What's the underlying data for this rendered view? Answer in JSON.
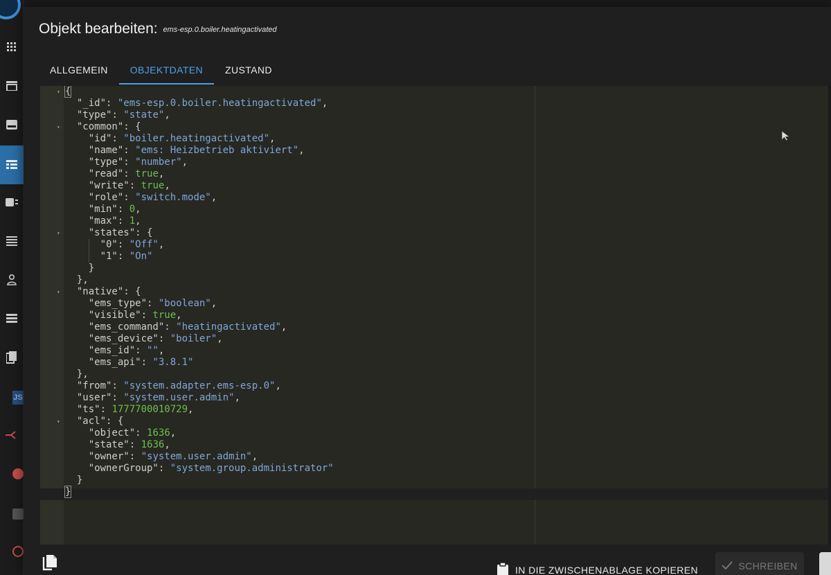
{
  "dialog": {
    "title": "Objekt bearbeiten:",
    "object_id": "ems-esp.0.boiler.heatingactivated"
  },
  "tabs": [
    {
      "label": "ALLGEMEIN"
    },
    {
      "label": "OBJEKTDATEN"
    },
    {
      "label": "ZUSTAND"
    }
  ],
  "active_tab": "OBJEKTDATEN",
  "json": {
    "id_key": "\"_id\"",
    "id_val": "\"ems-esp.0.boiler.heatingactivated\"",
    "type_key": "\"type\"",
    "type_val": "\"state\"",
    "common_key": "\"common\"",
    "common_id_key": "\"id\"",
    "common_id_val": "\"boiler.heatingactivated\"",
    "name_key": "\"name\"",
    "name_val": "\"ems: Heizbetrieb aktiviert\"",
    "ctype_key": "\"type\"",
    "ctype_val": "\"number\"",
    "read_key": "\"read\"",
    "read_val": "true",
    "write_key": "\"write\"",
    "write_val": "true",
    "role_key": "\"role\"",
    "role_val": "\"switch.mode\"",
    "min_key": "\"min\"",
    "min_val": "0",
    "max_key": "\"max\"",
    "max_val": "1",
    "states_key": "\"states\"",
    "s0_key": "\"0\"",
    "s0_val": "\"Off\"",
    "s1_key": "\"1\"",
    "s1_val": "\"On\"",
    "native_key": "\"native\"",
    "ems_type_key": "\"ems_type\"",
    "ems_type_val": "\"boolean\"",
    "visible_key": "\"visible\"",
    "visible_val": "true",
    "ems_command_key": "\"ems_command\"",
    "ems_command_val": "\"heatingactivated\"",
    "ems_device_key": "\"ems_device\"",
    "ems_device_val": "\"boiler\"",
    "ems_id_key": "\"ems_id\"",
    "ems_id_val": "\"\"",
    "ems_api_key": "\"ems_api\"",
    "ems_api_val": "\"3.8.1\"",
    "from_key": "\"from\"",
    "from_val": "\"system.adapter.ems-esp.0\"",
    "user_key": "\"user\"",
    "user_val": "\"system.user.admin\"",
    "ts_key": "\"ts\"",
    "ts_val": "1777700010729",
    "acl_key": "\"acl\"",
    "object_key": "\"object\"",
    "object_val": "1636",
    "state_key": "\"state\"",
    "state_val": "1636",
    "owner_key": "\"owner\"",
    "owner_val": "\"system.user.admin\"",
    "ownerGroup_key": "\"ownerGroup\"",
    "ownerGroup_val": "\"system.group.administrator\""
  },
  "footer": {
    "copy_label": "IN DIE ZWISCHENABLAGE KOPIEREN",
    "write_label": "SCHREIBEN"
  },
  "colors": {
    "accent": "#4ea1e6",
    "string": "#7fa6d8",
    "number": "#6dbf4f",
    "editor_bg": "#272822",
    "dialog_bg": "#1f1f1f"
  },
  "icons": [
    "dashboard-icon",
    "adapters-icon",
    "instances-icon",
    "objects-icon",
    "enums-icon",
    "logs-icon",
    "users-icon",
    "hosts-icon",
    "files-icon",
    "scripts-icon",
    "copy-icon",
    "clipboard-icon",
    "check-icon",
    "cursor-icon"
  ]
}
